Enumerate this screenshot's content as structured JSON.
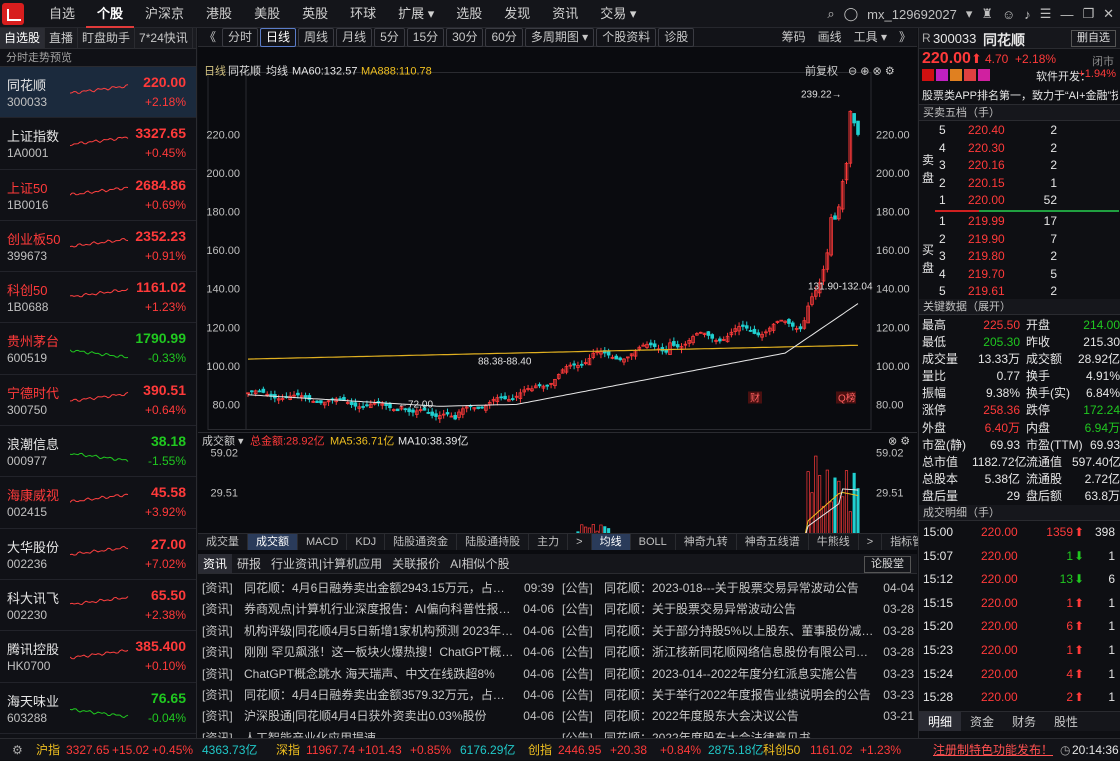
{
  "topbar": {
    "nav": [
      "自选",
      "个股",
      "沪深京",
      "港股",
      "美股",
      "英股",
      "环球",
      "扩展 ▾",
      "选股",
      "发现",
      "资讯",
      "交易 ▾"
    ],
    "user": "mx_129692027",
    "icons": [
      "search-icon",
      "avatar-icon",
      "user-icon",
      "shirt-icon",
      "bell-icon",
      "settings-icon",
      "minimize-icon",
      "restore-icon",
      "close-icon"
    ]
  },
  "left": {
    "tabs": [
      "自选股",
      "直播",
      "盯盘助手",
      "7*24快讯"
    ],
    "header": "分时走势预览",
    "items": [
      {
        "name": "同花顺",
        "code": "300033",
        "price": "220.00",
        "pct": "+2.18%",
        "dir": "up",
        "selected": true
      },
      {
        "name": "上证指数",
        "code": "1A0001",
        "price": "3327.65",
        "pct": "+0.45%",
        "dir": "up"
      },
      {
        "name": "上证50",
        "code": "1B0016",
        "price": "2684.86",
        "pct": "+0.69%",
        "dir": "up"
      },
      {
        "name": "创业板50",
        "code": "399673",
        "price": "2352.23",
        "pct": "+0.91%",
        "dir": "up"
      },
      {
        "name": "科创50",
        "code": "1B0688",
        "price": "1161.02",
        "pct": "+1.23%",
        "dir": "up"
      },
      {
        "name": "贵州茅台",
        "code": "600519",
        "price": "1790.99",
        "pct": "-0.33%",
        "dir": "dn"
      },
      {
        "name": "宁德时代",
        "code": "300750",
        "price": "390.51",
        "pct": "+0.64%",
        "dir": "up"
      },
      {
        "name": "浪潮信息",
        "code": "000977",
        "price": "38.18",
        "pct": "-1.55%",
        "dir": "dn"
      },
      {
        "name": "海康威视",
        "code": "002415",
        "price": "45.58",
        "pct": "+3.92%",
        "dir": "up"
      },
      {
        "name": "大华股份",
        "code": "002236",
        "price": "27.00",
        "pct": "+7.02%",
        "dir": "up"
      },
      {
        "name": "科大讯飞",
        "code": "002230",
        "price": "65.50",
        "pct": "+2.38%",
        "dir": "up"
      },
      {
        "name": "腾讯控股",
        "code": "HK0700",
        "price": "385.400",
        "pct": "+0.10%",
        "dir": "up"
      },
      {
        "name": "海天味业",
        "code": "603288",
        "price": "76.65",
        "pct": "-0.04%",
        "dir": "dn"
      }
    ]
  },
  "center": {
    "toolbar": [
      "分时",
      "日线",
      "周线",
      "月线",
      "5分",
      "15分",
      "30分",
      "60分",
      "多周期图 ▾",
      "个股资料",
      "诊股"
    ],
    "toolbar_right": [
      "筹码",
      "画线",
      "工具 ▾"
    ],
    "chart_header": {
      "period": "日线",
      "name": "同花顺",
      "ma_label": "均线",
      "ma60": "MA60:132.57",
      "ma888": "MA888:110.78",
      "fq": "前复权"
    },
    "vol_header": {
      "label": "成交额",
      "total": "总金额:28.92亿",
      "ma5": "MA5:36.71亿",
      "ma10": "MA10:38.39亿"
    },
    "vol_axis": {
      "top": "59.02",
      "mid": "29.51",
      "unit": "亿"
    },
    "annotations": {
      "high": "239.22",
      "low": "72.00",
      "mid1": "88.38-88.40",
      "mid2": "131.90-132.04",
      "tag1": "财",
      "tag2": "Q榜"
    },
    "time_axis": [
      "2022/08",
      "09",
      "10",
      "11",
      "12",
      "01",
      "02",
      "03",
      "04"
    ],
    "bottom_tabs": [
      "成交量",
      "成交额",
      "MACD",
      "KDJ",
      "陆股通资金",
      "陆股通持股",
      "主力"
    ],
    "bottom_tabs2": [
      "均线",
      "BOLL",
      "神奇九转",
      "神奇五线谱",
      "牛熊线"
    ],
    "indicator_btn": "指标管理"
  },
  "chart_data": {
    "type": "candlestick",
    "title": "同花顺 日线",
    "yticks": [
      80,
      100,
      120,
      140,
      160,
      180,
      200,
      220
    ],
    "ylim": [
      68,
      248
    ],
    "xlabels": [
      "2022/08",
      "09",
      "10",
      "11",
      "12",
      "01",
      "02",
      "03",
      "04"
    ],
    "current_price": 220.0,
    "series": [
      {
        "name": "MA60",
        "values_note": "smooth",
        "last": 132.57
      },
      {
        "name": "MA888",
        "last": 110.78
      }
    ],
    "key_points": [
      {
        "label": "high",
        "value": 239.22
      },
      {
        "label": "low",
        "value": 72.0
      }
    ]
  },
  "news": {
    "tabs": [
      "资讯",
      "研报",
      "行业资讯|计算机应用",
      "关联报价",
      "AI相似个股"
    ],
    "button": "论股堂",
    "left": [
      {
        "tag": "[资讯]",
        "title": "同花顺：4月6日融券卖出金额2943.15万元，占当日...",
        "date": "09:39"
      },
      {
        "tag": "[资讯]",
        "title": "券商观点|计算机行业深度报告：AI偏向科普性报告-...",
        "date": "04-06"
      },
      {
        "tag": "[资讯]",
        "title": "机构评级|同花顺4月5日新增1家机构预测 2023年净...",
        "date": "04-06"
      },
      {
        "tag": "[资讯]",
        "title": "刚刚 罕见飙涨！这一板块火爆热搜！ChatGPT概念...",
        "date": "04-06"
      },
      {
        "tag": "[资讯]",
        "title": "ChatGPT概念跳水 海天瑞声、中文在线跌超8%",
        "date": "04-06"
      },
      {
        "tag": "[资讯]",
        "title": "同花顺：4月4日融券卖出金额3579.32万元，占当日...",
        "date": "04-06"
      },
      {
        "tag": "[资讯]",
        "title": "沪深股通|同花顺4月4日获外资卖出0.03%股份",
        "date": "04-06"
      },
      {
        "tag": "[资讯]",
        "title": "人工智能产业化应用提速",
        "date": ""
      }
    ],
    "right": [
      {
        "tag": "[公告]",
        "title": "同花顺：2023-018---关于股票交易异常波动公告",
        "date": "04-04"
      },
      {
        "tag": "[公告]",
        "title": "同花顺：关于股票交易异常波动公告",
        "date": "03-28"
      },
      {
        "tag": "[公告]",
        "title": "同花顺：关于部分持股5%以上股东、董事股份减持...",
        "date": "03-28"
      },
      {
        "tag": "[公告]",
        "title": "同花顺：浙江核新同花顺网络信息股份有限公司202...",
        "date": "03-28"
      },
      {
        "tag": "[公告]",
        "title": "同花顺：2023-014--2022年度分红派息实施公告",
        "date": "03-23"
      },
      {
        "tag": "[公告]",
        "title": "同花顺：关于举行2022年度报告业绩说明会的公告",
        "date": "03-23"
      },
      {
        "tag": "[公告]",
        "title": "同花顺：2022年度股东大会决议公告",
        "date": "03-21"
      },
      {
        "tag": "[公告]",
        "title": "同花顺：2022年度股东大会法律意见书",
        "date": ""
      }
    ]
  },
  "right": {
    "code": "300033",
    "name": "同花顺",
    "del_btn": "删自选",
    "price": "220.00",
    "chg": "4.70",
    "pct": "+2.18%",
    "status": "闭市",
    "sector": "软件开发：",
    "sector_pct": "+1.94%",
    "desc": "股票类APP排名第一，致力于“AI+金融”技...",
    "ob_title": "买卖五档（手）",
    "sell_label": [
      "卖",
      "盘"
    ],
    "buy_label": [
      "买",
      "盘"
    ],
    "sells": [
      {
        "lvl": "5",
        "p": "220.40",
        "v": "2"
      },
      {
        "lvl": "4",
        "p": "220.30",
        "v": "2"
      },
      {
        "lvl": "3",
        "p": "220.16",
        "v": "2"
      },
      {
        "lvl": "2",
        "p": "220.15",
        "v": "1"
      },
      {
        "lvl": "1",
        "p": "220.00",
        "v": "52"
      }
    ],
    "buys": [
      {
        "lvl": "1",
        "p": "219.99",
        "v": "17"
      },
      {
        "lvl": "2",
        "p": "219.90",
        "v": "7"
      },
      {
        "lvl": "3",
        "p": "219.80",
        "v": "2"
      },
      {
        "lvl": "4",
        "p": "219.70",
        "v": "5"
      },
      {
        "lvl": "5",
        "p": "219.61",
        "v": "2"
      }
    ],
    "kd_title": "关键数据（展开）",
    "kd": [
      [
        "最高",
        "225.50",
        "up",
        "开盘",
        "214.00",
        "dn"
      ],
      [
        "最低",
        "205.30",
        "dn",
        "昨收",
        "215.30",
        "wh"
      ],
      [
        "成交量",
        "13.33万",
        "wh",
        "成交额",
        "28.92亿",
        "wh"
      ],
      [
        "量比",
        "0.77",
        "wh",
        "换手",
        "4.91%",
        "wh"
      ],
      [
        "振幅",
        "9.38%",
        "wh",
        "换手(实)",
        "6.84%",
        "wh"
      ],
      [
        "涨停",
        "258.36",
        "up",
        "跌停",
        "172.24",
        "dn"
      ],
      [
        "外盘",
        "6.40万",
        "up",
        "内盘",
        "6.94万",
        "dn"
      ],
      [
        "市盈(静)",
        "69.93",
        "wh",
        "市盈(TTM)",
        "69.93",
        "wh"
      ],
      [
        "总市值",
        "1182.72亿",
        "wh",
        "流通值",
        "597.40亿",
        "wh"
      ],
      [
        "总股本",
        "5.38亿",
        "wh",
        "流通股",
        "2.72亿",
        "wh"
      ],
      [
        "盘后量",
        "29",
        "wh",
        "盘后额",
        "63.8万",
        "wh"
      ]
    ],
    "tk_title": "成交明细（手）",
    "ticks": [
      {
        "t": "15:00",
        "p": "220.00",
        "v": "1359",
        "d": "up",
        "n": "398"
      },
      {
        "t": "15:07",
        "p": "220.00",
        "v": "1",
        "d": "dn",
        "n": "1"
      },
      {
        "t": "15:12",
        "p": "220.00",
        "v": "13",
        "d": "dn",
        "n": "6"
      },
      {
        "t": "15:15",
        "p": "220.00",
        "v": "1",
        "d": "up",
        "n": "1"
      },
      {
        "t": "15:20",
        "p": "220.00",
        "v": "6",
        "d": "up",
        "n": "1"
      },
      {
        "t": "15:23",
        "p": "220.00",
        "v": "1",
        "d": "up",
        "n": "1"
      },
      {
        "t": "15:24",
        "p": "220.00",
        "v": "4",
        "d": "up",
        "n": "1"
      },
      {
        "t": "15:28",
        "p": "220.00",
        "v": "2",
        "d": "up",
        "n": "1"
      }
    ],
    "bottom_tabs": [
      "明细",
      "资金",
      "财务",
      "股性"
    ]
  },
  "status": {
    "items": [
      {
        "name": "沪指",
        "val": "3327.65",
        "chg": "+15.02",
        "pct": "+0.45%",
        "amt": "4363.73亿"
      },
      {
        "name": "深指",
        "val": "11967.74",
        "chg": "+101.43",
        "pct": "+0.85%",
        "amt": "6176.29亿"
      },
      {
        "name": "创指",
        "val": "2446.95",
        "chg": "+20.38",
        "pct": "+0.84%",
        "amt": "2875.18亿"
      },
      {
        "name": "科创50",
        "val": "1161.02",
        "chg": "+1.23%",
        "pct": "",
        "": ""
      }
    ],
    "promo": "注册制特色功能发布！",
    "time": "20:14:36"
  }
}
